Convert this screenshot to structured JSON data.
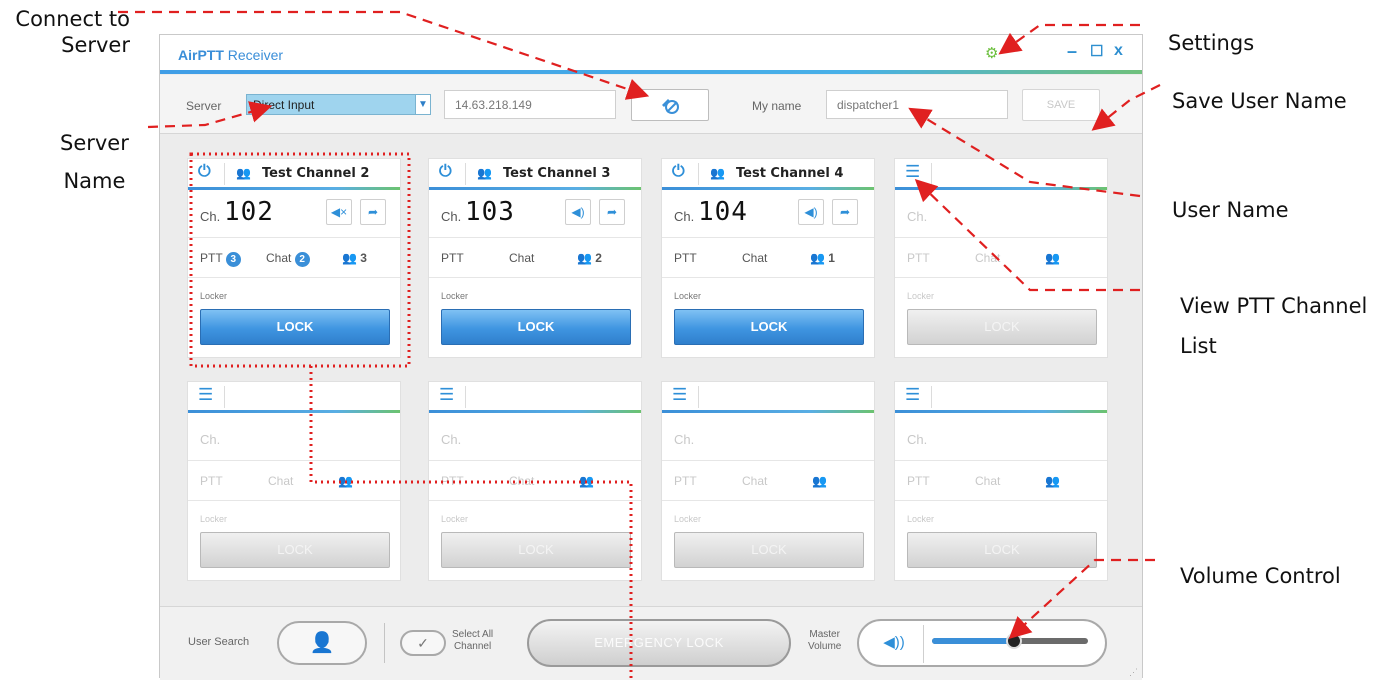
{
  "callouts": {
    "connect_to_server": "Connect to\nServer",
    "server_name_1": "Server",
    "server_name_2": "Name",
    "settings": "Settings",
    "save_user_name": "Save User Name",
    "user_name": "User Name",
    "view_ptt_channel_list_1": "View PTT Channel",
    "view_ptt_channel_list_2": "List",
    "volume_control": "Volume Control"
  },
  "window": {
    "title_brand": "AirPTT",
    "title_rest": " Receiver",
    "icons": [
      "gear-icon",
      "minimize-icon",
      "maximize-icon",
      "close-icon"
    ]
  },
  "toolbar": {
    "server_label": "Server",
    "server_value": "Direct Input",
    "server_ip": "14.63.218.149",
    "myname_label": "My name",
    "myname_value": "dispatcher1",
    "save_label": "SAVE"
  },
  "channels_active": [
    {
      "name": "Test Channel 2",
      "ch_label": "Ch.",
      "number": "102",
      "ptt": "PTT",
      "ptt_badge": "3",
      "chat": "Chat",
      "chat_badge": "2",
      "users": "3",
      "locker": "Locker",
      "lock": "LOCK",
      "speaker": "muted"
    },
    {
      "name": "Test Channel 3",
      "ch_label": "Ch.",
      "number": "103",
      "ptt": "PTT",
      "chat": "Chat",
      "users": "2",
      "locker": "Locker",
      "lock": "LOCK",
      "speaker": "on"
    },
    {
      "name": "Test Channel 4",
      "ch_label": "Ch.",
      "number": "104",
      "ptt": "PTT",
      "chat": "Chat",
      "users": "1",
      "locker": "Locker",
      "lock": "LOCK",
      "speaker": "on"
    }
  ],
  "channel_empty": {
    "ch_label": "Ch.",
    "ptt": "PTT",
    "chat": "Chat",
    "locker": "Locker",
    "lock": "LOCK"
  },
  "bottom": {
    "user_search": "User Search",
    "select_all_1": "Select All",
    "select_all_2": "Channel",
    "emergency_lock": "EMERGENCY LOCK",
    "master_volume_1": "Master",
    "master_volume_2": "Volume",
    "volume_level": 0.52
  },
  "colors": {
    "accent": "#3a8fd8",
    "arrow": "#e02020",
    "dots": "#e02020"
  }
}
